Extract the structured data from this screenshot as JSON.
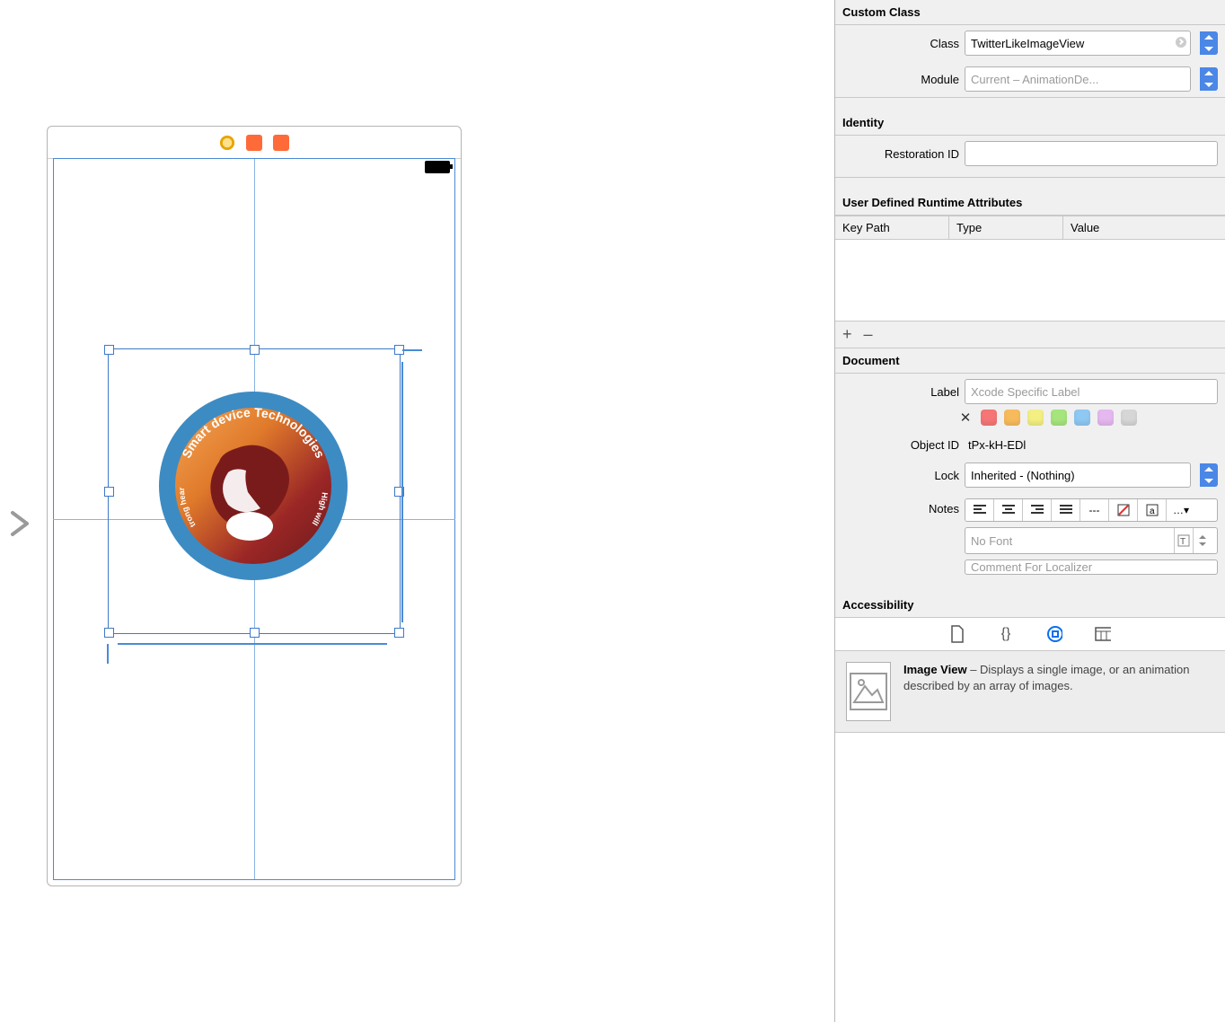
{
  "inspector": {
    "custom_class": {
      "title": "Custom Class",
      "class_label": "Class",
      "class_value": "TwitterLikeImageView",
      "module_label": "Module",
      "module_placeholder": "Current – AnimationDe..."
    },
    "identity": {
      "title": "Identity",
      "restoration_label": "Restoration ID",
      "restoration_value": ""
    },
    "runtime": {
      "title": "User Defined Runtime Attributes",
      "col_keypath": "Key Path",
      "col_type": "Type",
      "col_value": "Value"
    },
    "document": {
      "title": "Document",
      "label_label": "Label",
      "label_placeholder": "Xcode Specific Label",
      "swatch_colors": [
        "#f57676",
        "#f7bb5c",
        "#f3ef82",
        "#a6e57d",
        "#8ec8f3",
        "#e5b8ef",
        "#d6d6d6"
      ],
      "object_id_label": "Object ID",
      "object_id_value": "tPx-kH-EDl",
      "lock_label": "Lock",
      "lock_value": "Inherited - (Nothing)",
      "notes_label": "Notes",
      "font_placeholder": "No Font",
      "localizer_placeholder": "Comment For Localizer"
    },
    "accessibility": {
      "title": "Accessibility"
    },
    "quickhelp": {
      "title": "Image View",
      "body": " – Displays a single image, or an animation described by an array of images."
    }
  },
  "logo": {
    "top": "Smart device Technologies",
    "left": "Strong heart",
    "right": "High will"
  }
}
